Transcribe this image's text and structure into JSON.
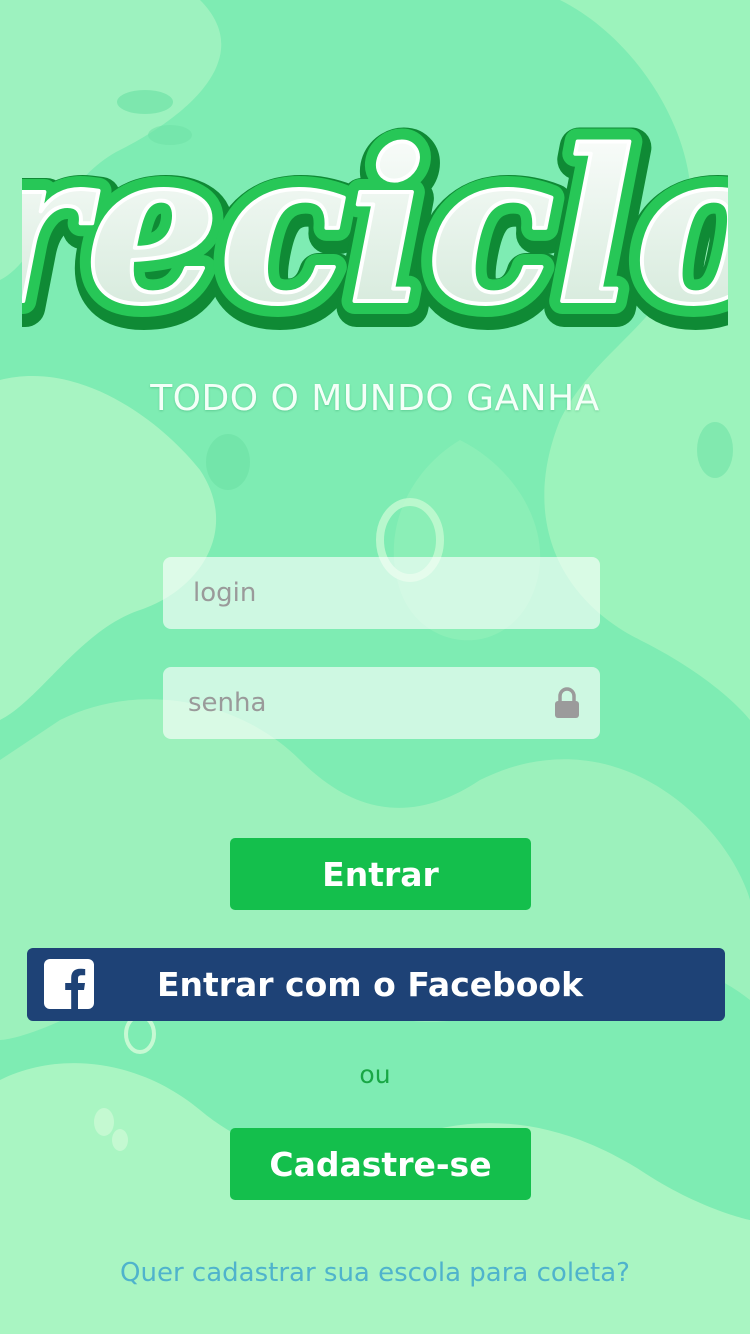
{
  "brand": {
    "logo_text": "reciclo",
    "tagline": "TODO O MUNDO GANHA"
  },
  "form": {
    "login_placeholder": "login",
    "password_placeholder": "senha",
    "lock_icon": "lock-icon"
  },
  "buttons": {
    "enter": "Entrar",
    "facebook": "Entrar com o Facebook",
    "facebook_icon": "facebook-icon",
    "signup": "Cadastre-se"
  },
  "or_text": "ou",
  "school_link": "Quer cadastrar sua escola para coleta?",
  "colors": {
    "background": "#7eecb3",
    "accent_green": "#14bf4c",
    "facebook_blue": "#1e4276",
    "link": "#4fb3cc",
    "or_text": "#19a745"
  }
}
